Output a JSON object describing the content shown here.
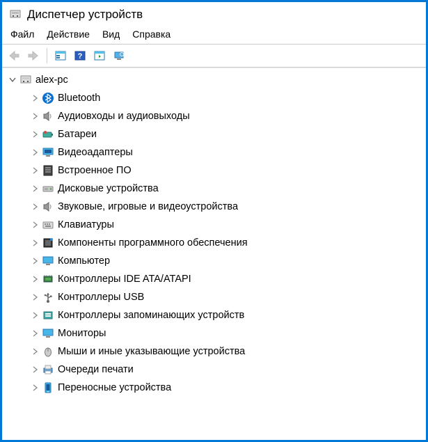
{
  "window": {
    "title": "Диспетчер устройств"
  },
  "menu": {
    "file": "Файл",
    "action": "Действие",
    "view": "Вид",
    "help": "Справка"
  },
  "tree": {
    "root": {
      "label": "alex-pc",
      "expanded": true
    },
    "items": [
      {
        "label": "Bluetooth",
        "icon": "bluetooth"
      },
      {
        "label": "Аудиовходы и аудиовыходы",
        "icon": "speaker"
      },
      {
        "label": "Батареи",
        "icon": "battery"
      },
      {
        "label": "Видеоадаптеры",
        "icon": "display"
      },
      {
        "label": "Встроенное ПО",
        "icon": "firmware"
      },
      {
        "label": "Дисковые устройства",
        "icon": "disk"
      },
      {
        "label": "Звуковые, игровые и видеоустройства",
        "icon": "speaker"
      },
      {
        "label": "Клавиатуры",
        "icon": "keyboard"
      },
      {
        "label": "Компоненты программного обеспечения",
        "icon": "software"
      },
      {
        "label": "Компьютер",
        "icon": "monitor"
      },
      {
        "label": "Контроллеры IDE ATA/ATAPI",
        "icon": "ide"
      },
      {
        "label": "Контроллеры USB",
        "icon": "usb"
      },
      {
        "label": "Контроллеры запоминающих устройств",
        "icon": "storage"
      },
      {
        "label": "Мониторы",
        "icon": "monitor"
      },
      {
        "label": "Мыши и иные указывающие устройства",
        "icon": "mouse"
      },
      {
        "label": "Очереди печати",
        "icon": "printer"
      },
      {
        "label": "Переносные устройства",
        "icon": "portable"
      }
    ]
  }
}
